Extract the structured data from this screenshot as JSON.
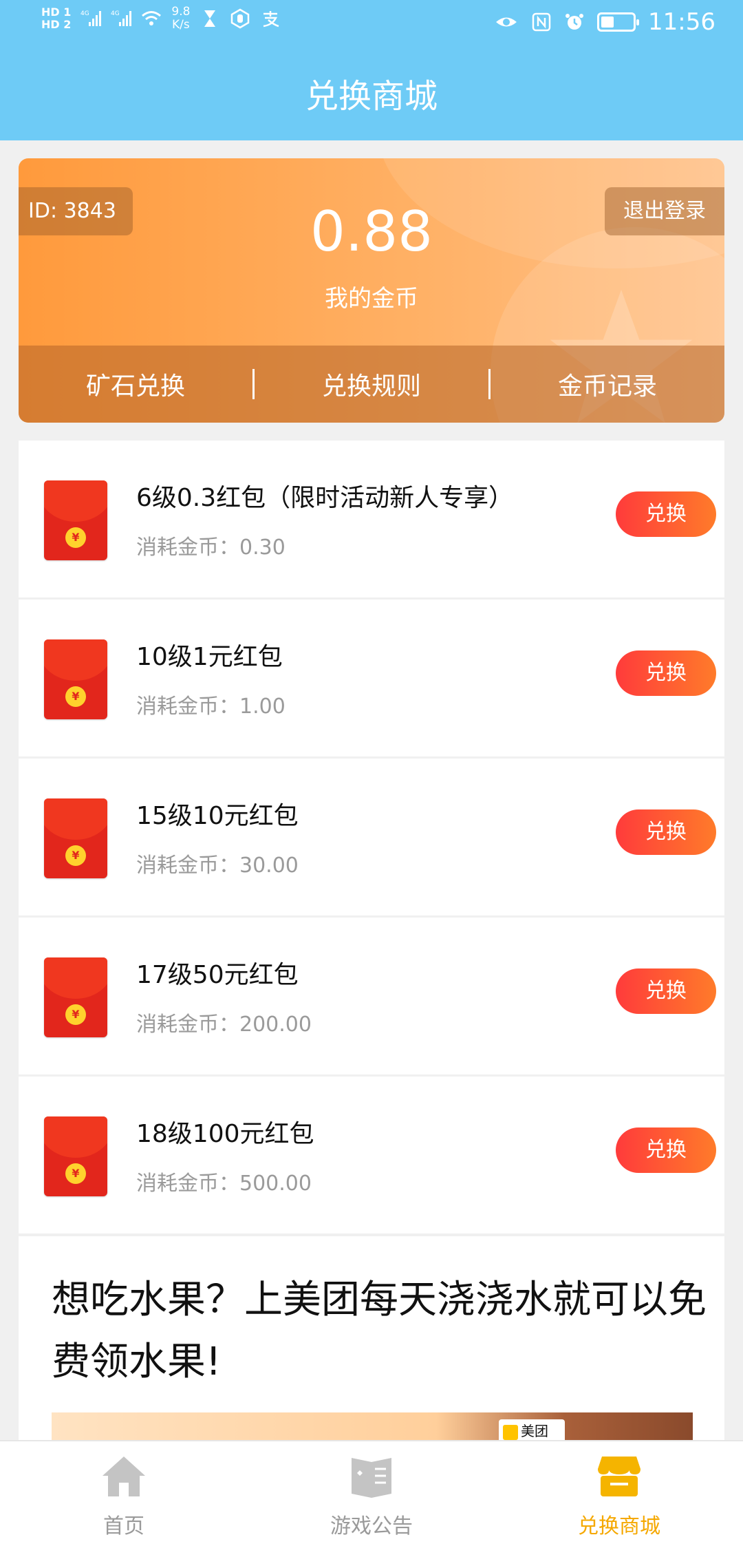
{
  "status_bar": {
    "hd1": "HD 1",
    "hd2": "HD 2",
    "signal1": "4G",
    "signal2": "4G",
    "speed_value": "9.8",
    "speed_unit": "K/s",
    "time": "11:56"
  },
  "header": {
    "title": "兑换商城"
  },
  "coin_card": {
    "id_label": "ID: 3843",
    "logout_label": "退出登录",
    "coin_value": "0.88",
    "coin_label": "我的金币",
    "tabs": [
      "矿石兑换",
      "兑换规则",
      "金币记录"
    ]
  },
  "items": [
    {
      "title": "6级0.3红包（限时活动新人专享）",
      "cost": "消耗金币：0.30",
      "button": "兑换"
    },
    {
      "title": "10级1元红包",
      "cost": "消耗金币：1.00",
      "button": "兑换"
    },
    {
      "title": "15级10元红包",
      "cost": "消耗金币：30.00",
      "button": "兑换"
    },
    {
      "title": "17级50元红包",
      "cost": "消耗金币：200.00",
      "button": "兑换"
    },
    {
      "title": "18级100元红包",
      "cost": "消耗金币：500.00",
      "button": "兑换"
    }
  ],
  "article": {
    "text": "想吃水果？上美团每天浇浇水就可以免费领水果!",
    "badge": "美团"
  },
  "bottom_nav": [
    {
      "label": "首页",
      "icon": "home-icon",
      "active": false
    },
    {
      "label": "游戏公告",
      "icon": "announcement-icon",
      "active": false
    },
    {
      "label": "兑换商城",
      "icon": "store-icon",
      "active": true
    }
  ],
  "colors": {
    "header_bg": "#6ecbf6",
    "accent_orange": "#ff9a3c",
    "button_red": "#ff3b3b",
    "active_nav": "#f5a800"
  }
}
